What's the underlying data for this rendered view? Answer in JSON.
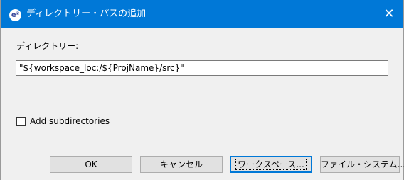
{
  "window": {
    "title": "ディレクトリー・パスの追加",
    "app_icon": "e²",
    "close_glyph": "✕"
  },
  "form": {
    "directory_label": "ディレクトリー:",
    "directory_value": "\"${workspace_loc:/${ProjName}/src}\"",
    "add_subdirectories_label": "Add subdirectories",
    "add_subdirectories_checked": false
  },
  "buttons": {
    "ok": "OK",
    "cancel": "キャンセル",
    "workspace": "ワークスペース...",
    "file_system": "ファイル・システム..."
  },
  "colors": {
    "titlebar": "#0078d7",
    "focus_border": "#0078d7"
  },
  "icons": {
    "app": "eclipse-app-icon",
    "close": "close-icon"
  }
}
